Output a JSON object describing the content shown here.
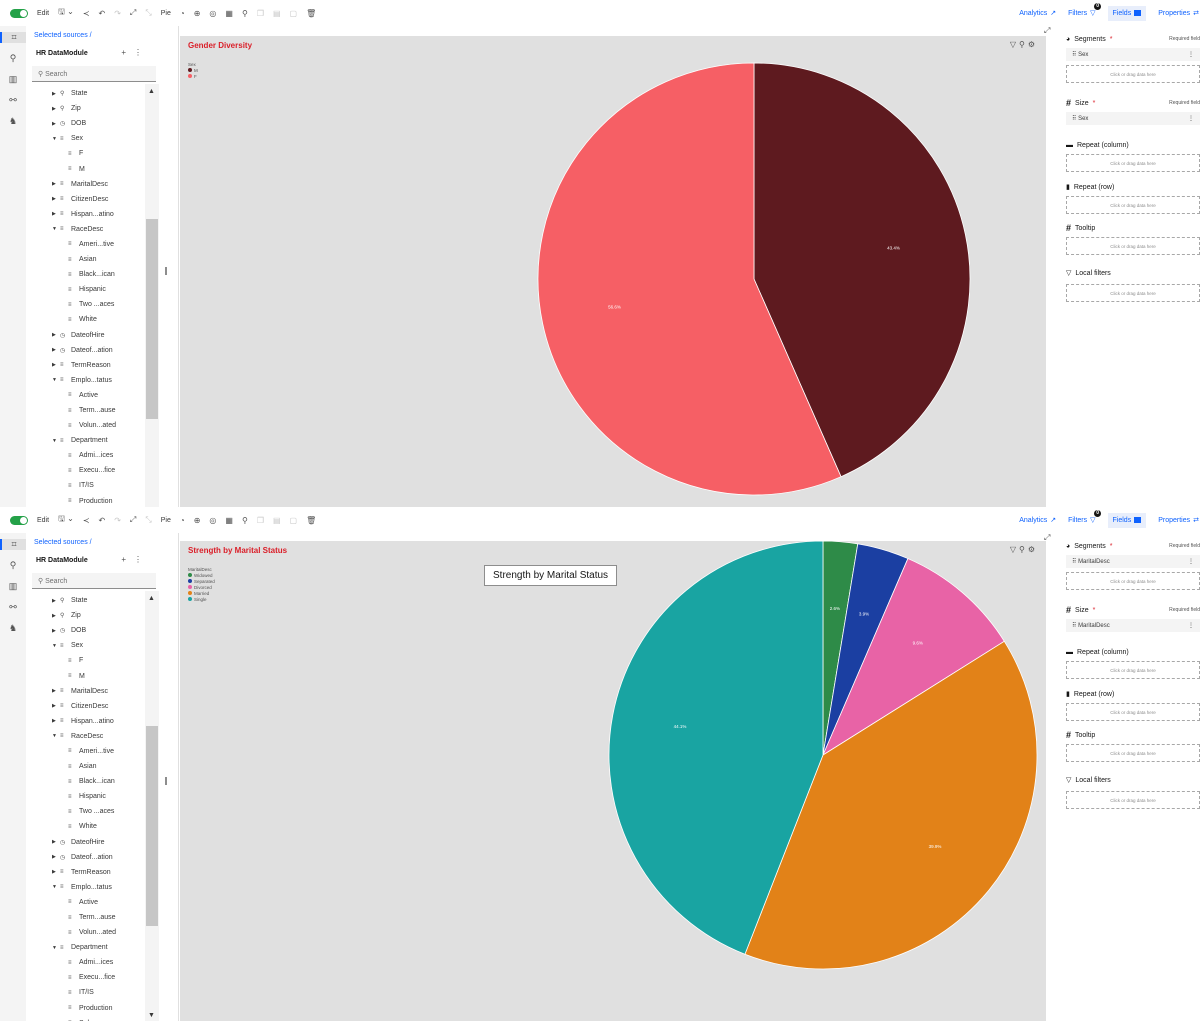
{
  "toolbar": {
    "edit_label": "Edit",
    "viz_label": "Pie",
    "right_tabs": [
      "Analytics",
      "Filters",
      "Fields",
      "Properties"
    ],
    "filters_badge": "0"
  },
  "datapanel": {
    "breadcrumb": "Selected sources /",
    "module": "HR DataModule",
    "search_placeholder": "Search",
    "tree_top": [
      "State",
      "Zip",
      "DOB",
      "Sex",
      "F",
      "M",
      "MaritalDesc",
      "CitizenDesc",
      "Hispan...atino",
      "RaceDesc",
      "Ameri...tive",
      "Asian",
      "Black...ican",
      "Hispanic",
      "Two ...aces",
      "White",
      "DateofHire",
      "Dateof...ation",
      "TermReason",
      "Emplo...tatus",
      "Active",
      "Term...ause",
      "Volun...ated",
      "Department",
      "Admi...ices",
      "Execu...fice",
      "IT/IS",
      "Production"
    ],
    "tree_bottom": [
      "State",
      "Zip",
      "DOB",
      "Sex",
      "F",
      "M",
      "MaritalDesc",
      "CitizenDesc",
      "Hispan...atino",
      "RaceDesc",
      "Ameri...tive",
      "Asian",
      "Black...ican",
      "Hispanic",
      "Two ...aces",
      "White",
      "DateofHire",
      "Dateof...ation",
      "TermReason",
      "Emplo...tatus",
      "Active",
      "Term...ause",
      "Volun...ated",
      "Department",
      "Admi...ices",
      "Execu...fice",
      "IT/IS",
      "Production",
      "Sales"
    ]
  },
  "props": {
    "segments_label": "Segments",
    "size_label": "Size",
    "required": "Required field",
    "repeat_col": "Repeat (column)",
    "repeat_row": "Repeat (row)",
    "tooltip": "Tooltip",
    "local_filters": "Local filters",
    "drop_hint": "Click or drag data here",
    "top_field": "Sex",
    "bottom_field": "MaritalDesc"
  },
  "chart_data": [
    {
      "type": "pie",
      "title": "Gender Diversity",
      "legend_title": "Sex",
      "slices": [
        {
          "label": "M",
          "value": 43.4,
          "display": "43.4%",
          "color": "#5e1a1f"
        },
        {
          "label": "F",
          "value": 56.6,
          "display": "56.6%",
          "color": "#f65f65"
        }
      ]
    },
    {
      "type": "pie",
      "title": "Strength by Marital Status",
      "tooltip": "Strength by Marital Status",
      "legend_title": "MaritalDesc",
      "slices": [
        {
          "label": "Widowed",
          "value": 2.6,
          "display": "2.6%",
          "color": "#2e8b48"
        },
        {
          "label": "Separated",
          "value": 3.9,
          "display": "3.9%",
          "color": "#1b3fa2"
        },
        {
          "label": "Divorced",
          "value": 9.6,
          "display": "9.6%",
          "color": "#e863a6"
        },
        {
          "label": "Married",
          "value": 39.9,
          "display": "39.9%",
          "color": "#e28218"
        },
        {
          "label": "Single",
          "value": 44.1,
          "display": "44.1%",
          "color": "#19a4a2"
        }
      ]
    }
  ]
}
